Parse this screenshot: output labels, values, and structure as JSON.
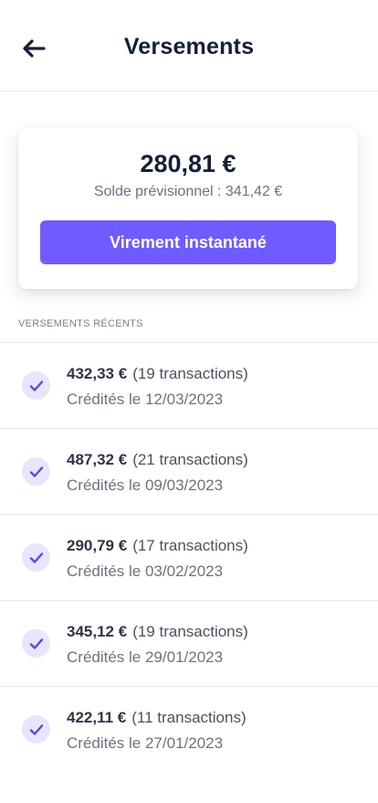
{
  "header": {
    "title": "Versements",
    "back_icon": "arrow-left-icon"
  },
  "balance": {
    "amount": "280,81 €",
    "forecast": "Solde prévisionnel : 341,42 €",
    "button_label": "Virement instantané"
  },
  "section": {
    "heading": "VERSEMENTS RÉCENTS"
  },
  "payouts": [
    {
      "amount": "432,33 €",
      "transactions": "(19 transactions)",
      "credited": "Crédités le 12/03/2023"
    },
    {
      "amount": "487,32 €",
      "transactions": "(21 transactions)",
      "credited": "Crédités le 09/03/2023"
    },
    {
      "amount": "290,79 €",
      "transactions": "(17 transactions)",
      "credited": "Crédités le 03/02/2023"
    },
    {
      "amount": "345,12 €",
      "transactions": "(19 transactions)",
      "credited": "Crédités le 29/01/2023"
    },
    {
      "amount": "422,11 €",
      "transactions": "(11 transactions)",
      "credited": "Crédités le 27/01/2023"
    }
  ],
  "colors": {
    "accent": "#6f5bff",
    "check_bg": "#e8e5ff",
    "title": "#142035",
    "muted": "#6d7280"
  }
}
